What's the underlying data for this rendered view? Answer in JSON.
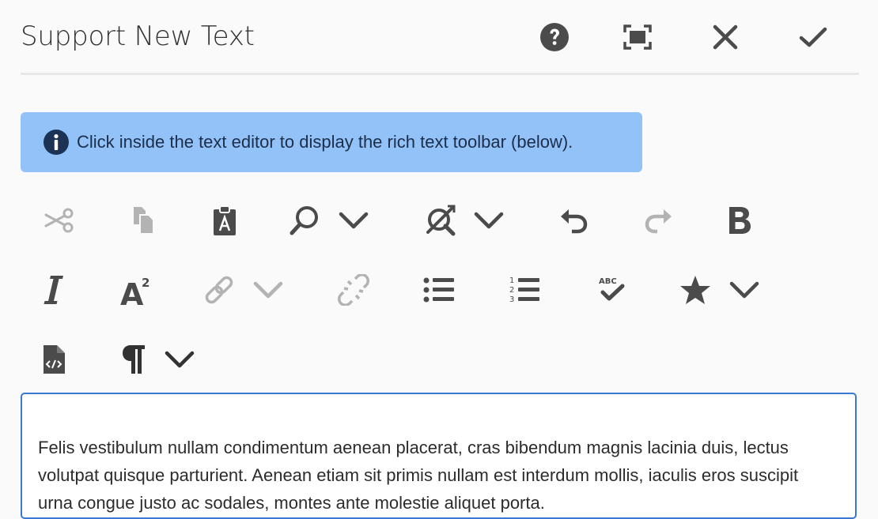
{
  "dialog": {
    "title": "Support New Text",
    "header_buttons": [
      {
        "name": "help-button",
        "icon": "help-icon"
      },
      {
        "name": "fullscreen-button",
        "icon": "fullscreen-icon"
      },
      {
        "name": "close-button",
        "icon": "close-icon"
      },
      {
        "name": "done-button",
        "icon": "checkmark-icon"
      }
    ]
  },
  "info": {
    "icon": "info-icon",
    "message": "Click inside the text editor to display the rich text toolbar (below)."
  },
  "toolbar": {
    "rows": [
      [
        "cut",
        "copy",
        "paste-plain",
        "find",
        "find-dropdown",
        "spellcheck-replace",
        "replace-dropdown",
        "undo",
        "redo",
        "bold"
      ],
      [
        "italic",
        "superscript",
        "link",
        "link-dropdown",
        "unlink",
        "bullet-list",
        "numbered-list",
        "spellcheck",
        "special-char",
        "special-char-dropdown"
      ],
      [
        "source-edit",
        "paragraph-format",
        "paragraph-dropdown"
      ]
    ],
    "numbered_list_digits": [
      "1",
      "2",
      "3"
    ],
    "spellcheck_letters": "ABC",
    "superscript_base": "A",
    "superscript_exponent": "2",
    "colors": {
      "active": "#4b4b4b",
      "disabled": "#b3b3b3"
    }
  },
  "editor": {
    "text": "Felis vestibulum nullam condimentum aenean placerat, cras bibendum magnis lacinia duis, lectus volutpat quisque parturient. Aenean etiam sit primis nullam est interdum mollis, iaculis eros suscipit urna congue justo ac sodales, montes ante molestie aliquet porta."
  }
}
